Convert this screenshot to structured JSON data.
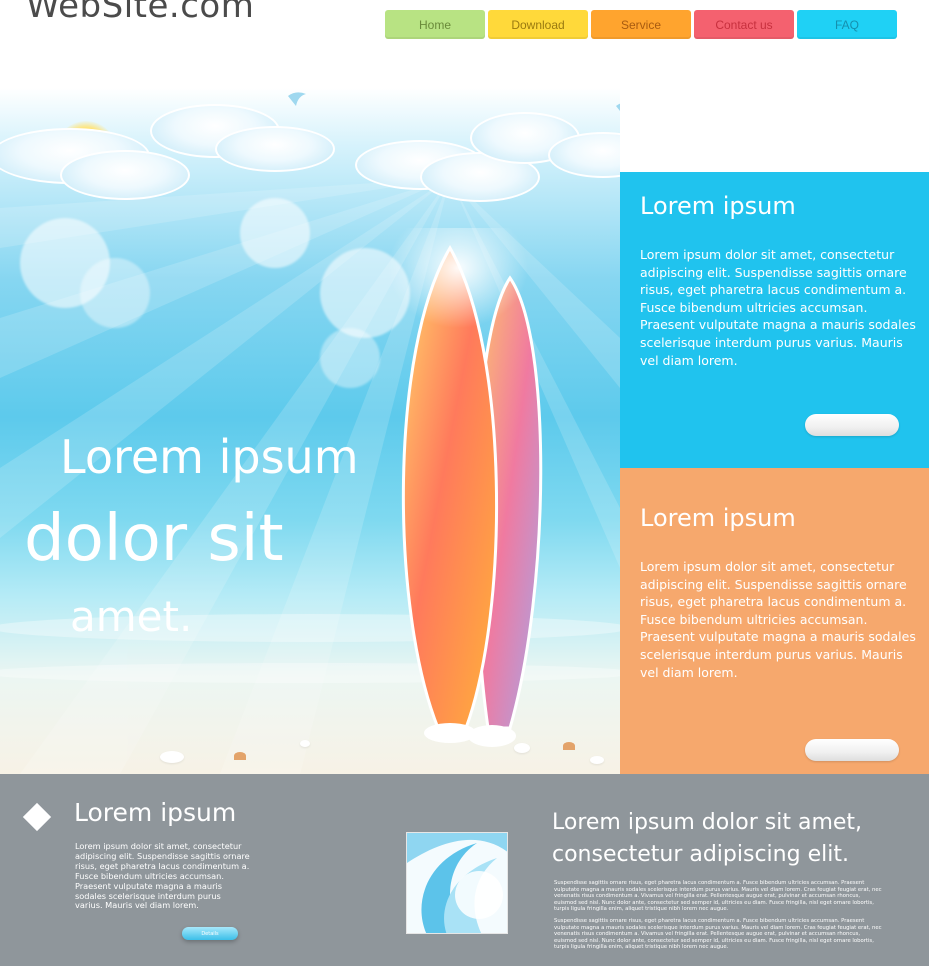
{
  "header": {
    "logo": "WebSite.com",
    "nav": [
      {
        "label": "Home",
        "bg": "#b8e383",
        "fg": "#6a8a3a"
      },
      {
        "label": "Download",
        "bg": "#ffd93a",
        "fg": "#9a7a10"
      },
      {
        "label": "Service",
        "bg": "#ffa42e",
        "fg": "#a85b10"
      },
      {
        "label": "Contact us",
        "bg": "#f4616f",
        "fg": "#c7303e"
      },
      {
        "label": "FAQ",
        "bg": "#1fd1f5",
        "fg": "#1590ae"
      }
    ]
  },
  "hero": {
    "line1": "Lorem ipsum",
    "line2": "dolor sit",
    "line3": "amet."
  },
  "panels": [
    {
      "title": "Lorem ipsum",
      "body": "Lorem ipsum dolor sit amet, consectetur adipiscing elit. Suspendisse sagittis ornare risus, eget pharetra lacus condimentum a. Fusce bibendum ultricies accumsan. Praesent vulputate magna a mauris sodales scelerisque interdum purus varius. Mauris vel diam lorem.",
      "color": "#20c3ee"
    },
    {
      "title": "Lorem ipsum",
      "body": "Lorem ipsum dolor sit amet, consectetur adipiscing elit. Suspendisse sagittis ornare risus, eget pharetra lacus condimentum a. Fusce bibendum ultricies accumsan. Praesent vulputate magna a mauris sodales scelerisque interdum purus varius. Mauris vel diam lorem.",
      "color": "#f6a86d"
    }
  ],
  "footer": {
    "title": "Lorem ipsum",
    "body": "Lorem ipsum dolor sit amet, consectetur adipiscing elit. Suspendisse sagittis ornare risus, eget pharetra lacus condimentum a. Fusce bibendum ultricies accumsan. Praesent vulputate magna a mauris sodales scelerisque interdum purus varius. Mauris vel diam lorem.",
    "button": "Details",
    "headline": "Lorem ipsum dolor sit amet, consectetur adipiscing elit.",
    "small_1": "Suspendisse sagittis ornare risus, eget pharetra lacus condimentum a. Fusce bibendum ultricies accumsan. Praesent vulputate magna a mauris sodales scelerisque interdum purus varius. Mauris vel diam lorem. Cras feugiat feugiat erat, nec venenatis risus condimentum a. Vivamus vel fringilla erat. Pellentesque augue erat, pulvinar et accumsan rhoncus, euismod sed nisl. Nunc dolor ante, consectetur sed semper id, ultricies eu diam. Fusce fringilla, nisl eget ornare lobortis, turpis ligula fringilla enim, aliquet tristique nibh lorem nec augue.",
    "small_2": "Suspendisse sagittis ornare risus, eget pharetra lacus condimentum a. Fusce bibendum ultricies accumsan. Praesent vulputate magna a mauris sodales scelerisque interdum purus varius. Mauris vel diam lorem. Cras feugiat feugiat erat, nec venenatis risus condimentum a. Vivamus vel fringilla erat. Pellentesque augue erat, pulvinar et accumsan rhoncus, euismod sed nisl. Nunc dolor ante, consectetur sed semper id, ultricies eu diam. Fusce fringilla, nisl eget ornare lobortis, turpis ligula fringilla enim, aliquet tristique nibh lorem nec augue."
  }
}
